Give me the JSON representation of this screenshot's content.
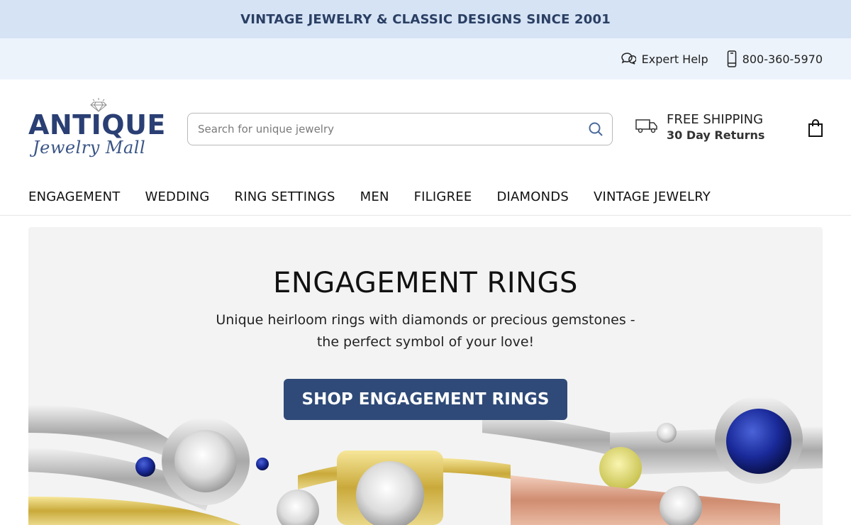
{
  "promo": {
    "text": "VINTAGE JEWELRY & CLASSIC DESIGNS SINCE 2001"
  },
  "utility": {
    "expert_help": {
      "label": "Expert Help",
      "icon": "chat-bubbles-icon"
    },
    "phone": {
      "label": "800-360-5970",
      "icon": "phone-icon"
    }
  },
  "logo": {
    "main": "ANTIQUE",
    "script": "Jewelry Mall",
    "icon": "diamond-icon"
  },
  "search": {
    "placeholder": "Search for unique jewelry",
    "value": "",
    "icon": "search-icon"
  },
  "shipping": {
    "line1": "FREE SHIPPING",
    "line2": "30 Day Returns",
    "icon": "truck-icon"
  },
  "cart": {
    "icon": "shopping-bag-icon"
  },
  "nav": {
    "items": [
      {
        "label": "ENGAGEMENT"
      },
      {
        "label": "WEDDING"
      },
      {
        "label": "RING SETTINGS"
      },
      {
        "label": "MEN"
      },
      {
        "label": "FILIGREE"
      },
      {
        "label": "DIAMONDS"
      },
      {
        "label": "VINTAGE JEWELRY"
      }
    ]
  },
  "hero": {
    "title": "ENGAGEMENT RINGS",
    "subtitle": "Unique heirloom rings with diamonds or precious gemstones - the perfect symbol of your love!",
    "cta_label": "SHOP ENGAGEMENT RINGS"
  },
  "colors": {
    "promo_bg": "#d6e3f5",
    "utility_bg": "#ecf3fb",
    "brand_navy": "#2f4a78",
    "hero_bg": "#f3f3f3"
  }
}
